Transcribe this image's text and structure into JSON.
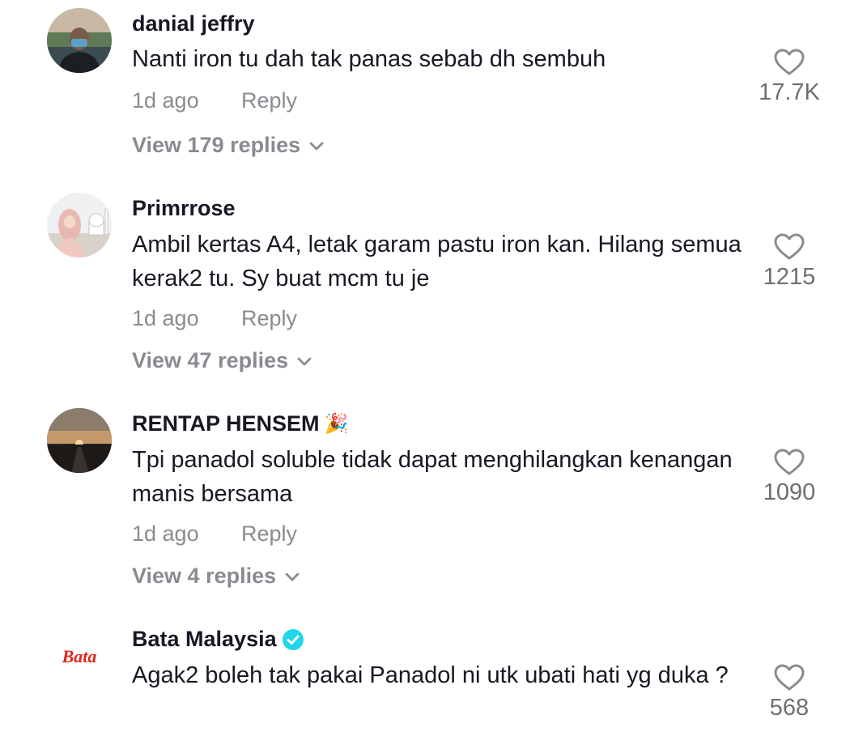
{
  "comments": [
    {
      "username": "danial jeffry",
      "text": "Nanti iron tu dah tak panas sebab dh sembuh",
      "time": "1d ago",
      "reply_label": "Reply",
      "view_replies": "View 179 replies",
      "likes": "17.7K",
      "avatar_icon": "person-avatar"
    },
    {
      "username": "Primrrose",
      "text": "Ambil kertas A4, letak garam pastu iron kan. Hilang semua kerak2 tu. Sy buat mcm tu je",
      "time": "1d ago",
      "reply_label": "Reply",
      "view_replies": "View 47 replies",
      "likes": "1215",
      "avatar_icon": "mosque-illustration-avatar"
    },
    {
      "username": "RENTAP HENSEM",
      "username_emoji": "🎉",
      "text": "Tpi panadol soluble tidak dapat menghilangkan kenangan manis bersama",
      "time": "1d ago",
      "reply_label": "Reply",
      "view_replies": "View 4 replies",
      "likes": "1090",
      "avatar_icon": "sunset-avatar"
    },
    {
      "username": "Bata Malaysia",
      "verified": true,
      "text": "Agak2 boleh tak pakai Panadol ni utk ubati hati yg duka ?",
      "likes": "568",
      "avatar_logo_text": "Bata",
      "avatar_icon": "bata-logo-avatar"
    }
  ],
  "colors": {
    "primary_text": "#161823",
    "secondary_text": "#8a8b91",
    "verified_badge": "#20d5ec",
    "bata_red": "#e1251b"
  }
}
